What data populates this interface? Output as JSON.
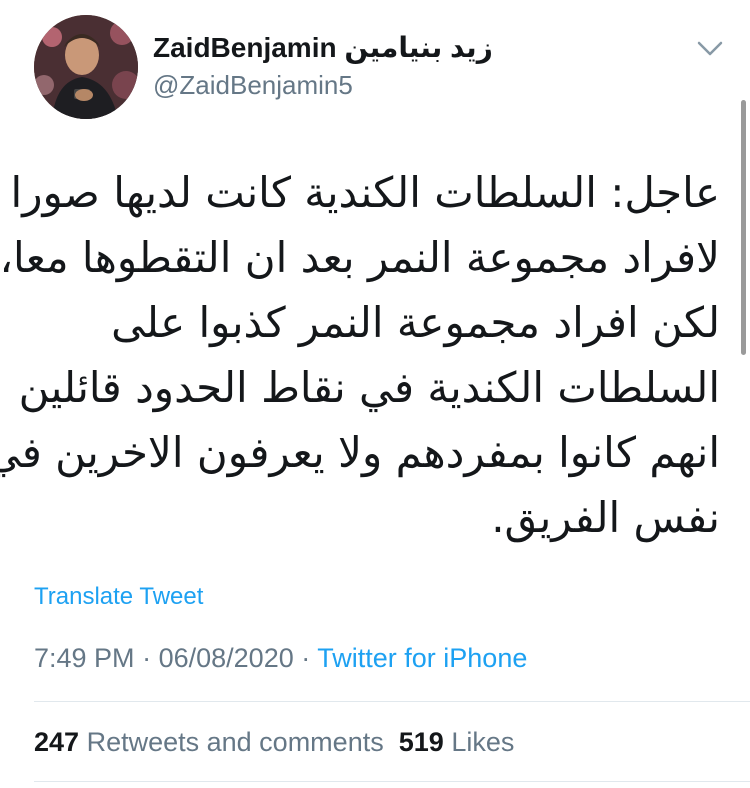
{
  "user": {
    "display_name": "ZaidBenjamin زيد بنيامين",
    "handle": "@ZaidBenjamin5"
  },
  "tweet": {
    "lines": [
      "عاجل: السلطات الكندية كانت لديها صورا",
      "لافراد مجموعة النمر بعد ان التقطوها معا،",
      "لكن افراد مجموعة النمر كذبوا على",
      "السلطات الكندية في نقاط الحدود قائلين",
      "انهم كانوا بمفردهم ولا يعرفون الاخرين في",
      "نفس الفريق."
    ],
    "translate_label": "Translate Tweet",
    "time": "7:49 PM",
    "date": "06/08/2020",
    "separator": "·",
    "source": "Twitter for iPhone"
  },
  "stats": {
    "retweets_count": "247",
    "retweets_label": "Retweets and comments",
    "likes_count": "519",
    "likes_label": "Likes"
  },
  "icons": {
    "more": "chevron-down-icon"
  },
  "colors": {
    "link": "#1da1f2",
    "secondary_text": "#657786",
    "primary_text": "#14171a",
    "divider": "#e1e8ed"
  }
}
